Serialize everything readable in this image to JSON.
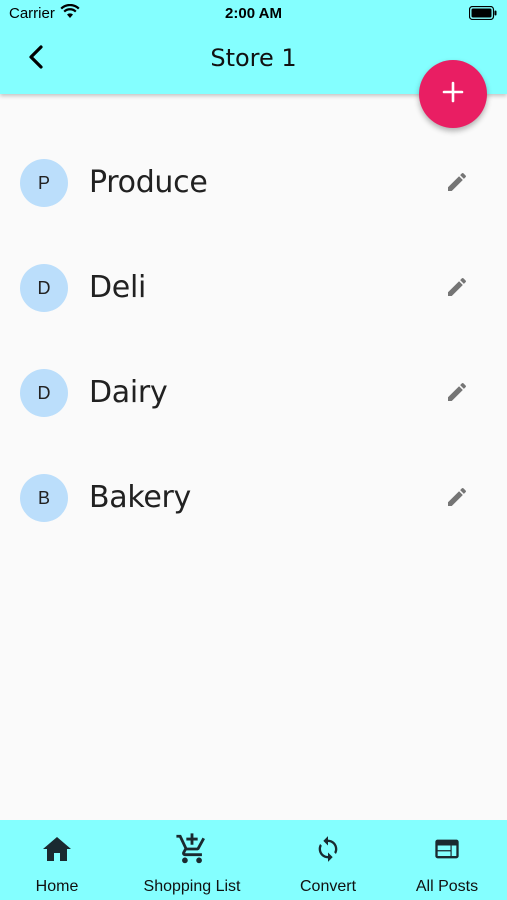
{
  "status_bar": {
    "carrier": "Carrier",
    "time": "2:00 AM"
  },
  "header": {
    "title": "Store 1",
    "back_icon": "chevron-left-icon",
    "background_color": "#84ffff"
  },
  "fab": {
    "icon": "plus-icon",
    "color": "#e91e63"
  },
  "list": {
    "items": [
      {
        "initial": "P",
        "label": "Produce"
      },
      {
        "initial": "D",
        "label": "Deli"
      },
      {
        "initial": "D",
        "label": "Dairy"
      },
      {
        "initial": "B",
        "label": "Bakery"
      }
    ],
    "avatar_color": "#bbdefb",
    "edit_icon": "pencil-icon"
  },
  "bottom_nav": {
    "items": [
      {
        "label": "Home",
        "icon": "home-icon"
      },
      {
        "label": "Shopping List",
        "icon": "cart-add-icon"
      },
      {
        "label": "Convert",
        "icon": "sync-icon"
      },
      {
        "label": "All Posts",
        "icon": "web-window-icon"
      }
    ]
  }
}
